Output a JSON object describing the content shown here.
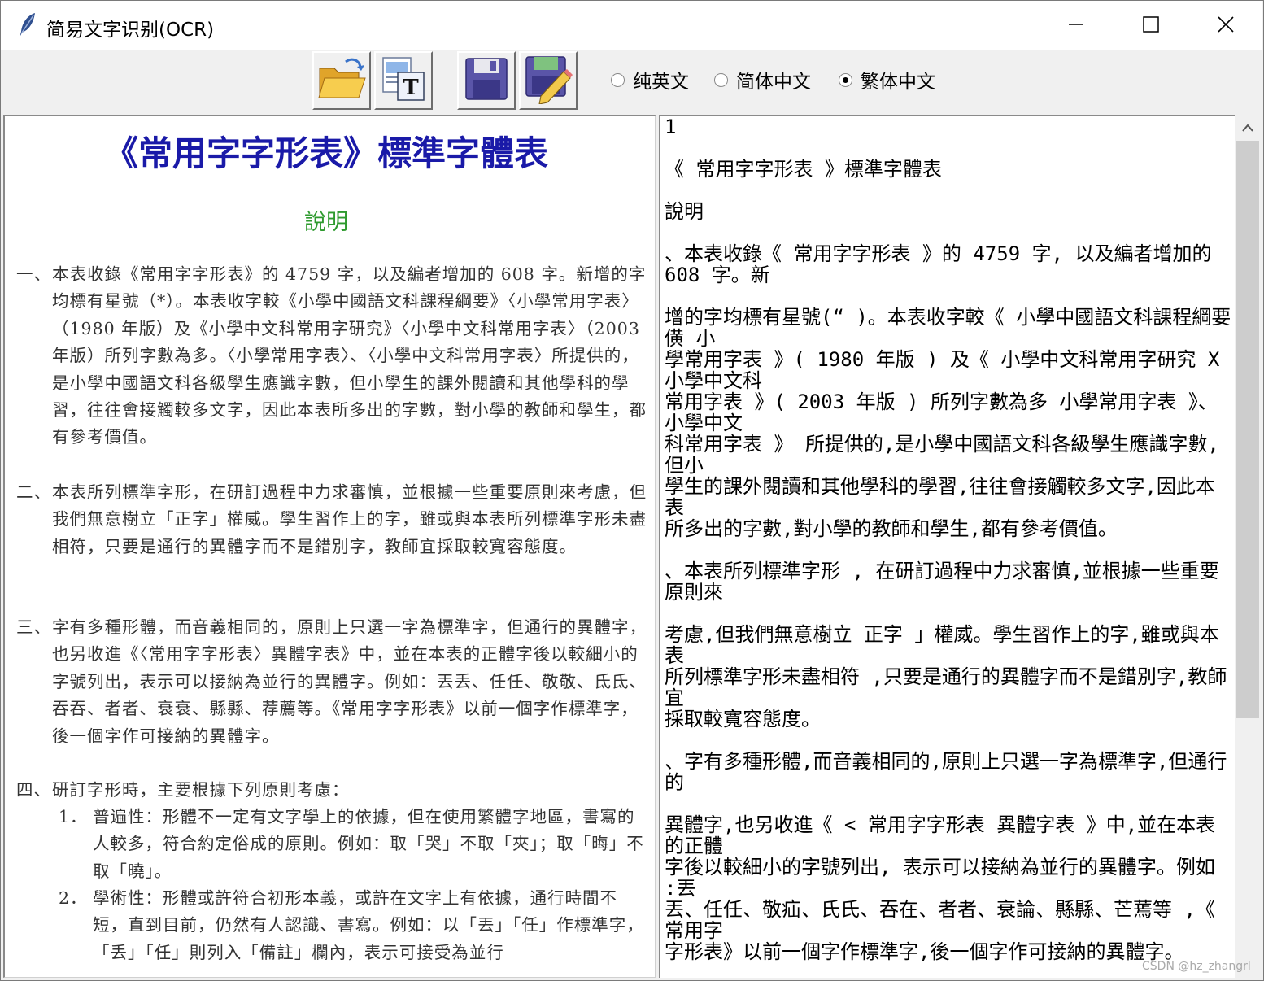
{
  "window": {
    "title": "简易文字识别(OCR)",
    "controls": {
      "minimize": "minimize",
      "maximize": "maximize",
      "close": "close"
    }
  },
  "toolbar": {
    "buttons": [
      {
        "icon": "open-folder-icon"
      },
      {
        "icon": "ocr-text-icon"
      },
      {
        "icon": "save-icon"
      },
      {
        "icon": "save-edit-icon"
      }
    ],
    "language_options": [
      {
        "label": "纯英文",
        "selected": false
      },
      {
        "label": "简体中文",
        "selected": false
      },
      {
        "label": "繁体中文",
        "selected": true
      }
    ]
  },
  "image_document": {
    "title": "《常用字字形表》標準字體表",
    "subtitle": "說明",
    "paragraphs": [
      {
        "num": "一、",
        "text": "本表收錄《常用字字形表》的 4759 字，以及編者增加的 608 字。新增的字均標有星號（*）。本表收字較《小學中國語文科課程綱要》〈小學常用字表〉（1980 年版）及《小學中文科常用字研究》〈小學中文科常用字表〉（2003 年版）所列字數為多。〈小學常用字表〉、〈小學中文科常用字表〉所提供的，是小學中國語文科各級學生應識字數，但小學生的課外閱讀和其他學科的學習，往往會接觸較多文字，因此本表所多出的字數，對小學的教師和學生，都有參考價值。"
      },
      {
        "num": "二、",
        "text": "本表所列標準字形，在研訂過程中力求審慎，並根據一些重要原則來考慮，但我們無意樹立「正字」權威。學生習作上的字，雖或與本表所列標準字形未盡相符，只要是通行的異體字而不是錯別字，教師宜採取較寬容態度。"
      },
      {
        "num": "三、",
        "text": "字有多種形體，而音義相同的，原則上只選一字為標準字，但通行的異體字，也另收進《〈常用字字形表〉異體字表》中，並在本表的正體字後以較細小的字號列出，表示可以接納為並行的異體字。例如：丟丢、任任、敬敬、氐氐、吞吞、者者、衰衰、縣縣、荐薦等。《常用字字形表》以前一個字作標準字，後一個字作可接納的異體字。"
      },
      {
        "num": "四、",
        "text": "研訂字形時，主要根據下列原則考慮："
      }
    ],
    "sub_items": [
      {
        "num": "1．",
        "text": "普遍性：形體不一定有文字學上的依據，但在使用繁體字地區，書寫的人較多，符合約定俗成的原則。例如：取「哭」不取「夾」；取「晦」不取「曉」。"
      },
      {
        "num": "2．",
        "text": "學術性：形體或許符合初形本義，或許在文字上有依據，通行時間不短，直到目前，仍然有人認識、書寫。例如：以「丟」「任」作標準字，「丢」「任」則列入「備註」欄內，表示可接受為並行"
      }
    ]
  },
  "ocr_result": "1\n\n《 常用字字形表 》標準字體表\n\n說明\n\n、本表收錄《 常用字字形表 》的 4759 字, 以及編者增加的 608 字。新\n\n增的字均標有星號(“ )。本表收字較《 小學中國語文科課程綱要僙 小\n學常用字表 》( 1980 年版 ) 及《 小學中文科常用字研究 X 小學中文科\n常用字表 》( 2003 年版 ) 所列字數為多 小學常用字表 》、 小學中文\n科常用字表 》 所提供的,是小學中國語文科各級學生應識字數,但小\n學生的課外閱讀和其他學科的學習,往往會接觸較多文字,因此本表\n所多出的字數,對小學的教師和學生,都有參考價值。\n\n、本表所列標準字形 , 在研訂過程中力求審慎,並根據一些重要原則來\n\n考慮,但我們無意樹立 正字 」權威。學生習作上的字,雖或與本表\n所列標準字形未盡相符 ,只要是通行的異體字而不是錯別字,教師宜\n採取較寬容態度。\n\n、字有多種形體,而音義相同的,原則上只選一字為標準字,但通行的\n\n異體字,也另收進《 < 常用字字形表 異體字表 》中,並在本表的正體\n字後以較細小的字號列出, 表示可以接納為並行的異體字。例如 :丟\n丟、任任、敬疝、氏氏、吞在、者者、衰論、縣縣、芒蔫等 ,《 常用字\n字形表》以前一個字作標準字,後一個字作可接納的異體字。",
  "watermark": "CSDN @hz_zhangrl"
}
